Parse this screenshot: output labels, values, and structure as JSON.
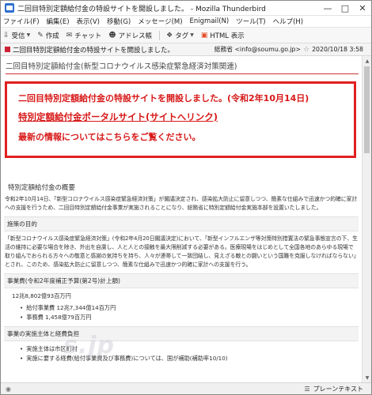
{
  "window": {
    "title": "二回目特別定額給付金の特設サイトを開設しました。 - Mozilla Thunderbird"
  },
  "menu": [
    "ファイル(F)",
    "編集(E)",
    "表示(V)",
    "移動(G)",
    "メッセージ(M)",
    "Enigmail(N)",
    "ツール(T)",
    "ヘルプ(H)"
  ],
  "toolbar": {
    "receive": "受信",
    "compose": "作成",
    "chat": "チャット",
    "address_book": "アドレス帳",
    "tag": "タグ",
    "html_view": "HTML 表示"
  },
  "header": {
    "subject": "二回目特別定額給付金の特設サイトを開設しました。",
    "from": "総務省 <info@soumu.go.jp>",
    "date": "2020/10/18 3:58"
  },
  "body": {
    "org_title": "二回目特別定額給付金(新型コロナウイルス感染症緊急経済対策関連)",
    "banner_line1": "二回目特別定額給付金の特設サイトを開設しました。(令和2年10月14日)",
    "banner_link": "特別定額給付金ポータルサイト(サイトへリンク)",
    "banner_line3": "最新の情報についてはこちらをご覧ください。",
    "section_title": "特別定額給付金の概要",
    "para1": "令和2年10月14日、「新型コロナウイルス感染症緊急経済対策」が閣議決定され、感染拡大防止に留意しつつ、簡素な仕組みで迅速かつ的確に家計への支援を行うため、二回目特別定額給付金事業が実施されることになり、総務省に特別定額給付金実施本部を設置いたしました。",
    "purpose_head": "施策の目的",
    "para2": "「新型コロナウイルス感染症緊急経済対策」(令和2年4月20日閣議決定)において、「新型インフルエンザ等対策特別措置法の緊急事態宣言の下、生活の維持に必要な場合を除き、外出を自粛し、人と人との接触を最大限削減する必要がある。医療現場をはじめとして全国各地のあらゆる現場で取り組んでおられる方々への敬意と感謝の気持ちを持ち、人々が連帯して一致団結し、見えざる敵との闘いという国難を克服しなければならない」とされ、このため、感染拡大防止に留意しつつ、簡素な仕組みで迅速かつ的確に家計への支援を行う。",
    "budget_head": "事業費(令和2年度補正予算(第2号)計上額)",
    "budget_total": "12兆8,802億93百万円",
    "budget_items": [
      "給付事業費 12兆7,344億14百万円",
      "事務費 1,458億79百万円"
    ],
    "impl_head": "事業の実施主体と経費負担",
    "impl_items": [
      "実施主体は市区町村",
      "実施に要する経費(給付事業費及び事務費)については、国が補助(補助率10/10)"
    ],
    "watermark": "s.jp"
  },
  "statusbar": {
    "mode": "プレーンテキスト"
  }
}
